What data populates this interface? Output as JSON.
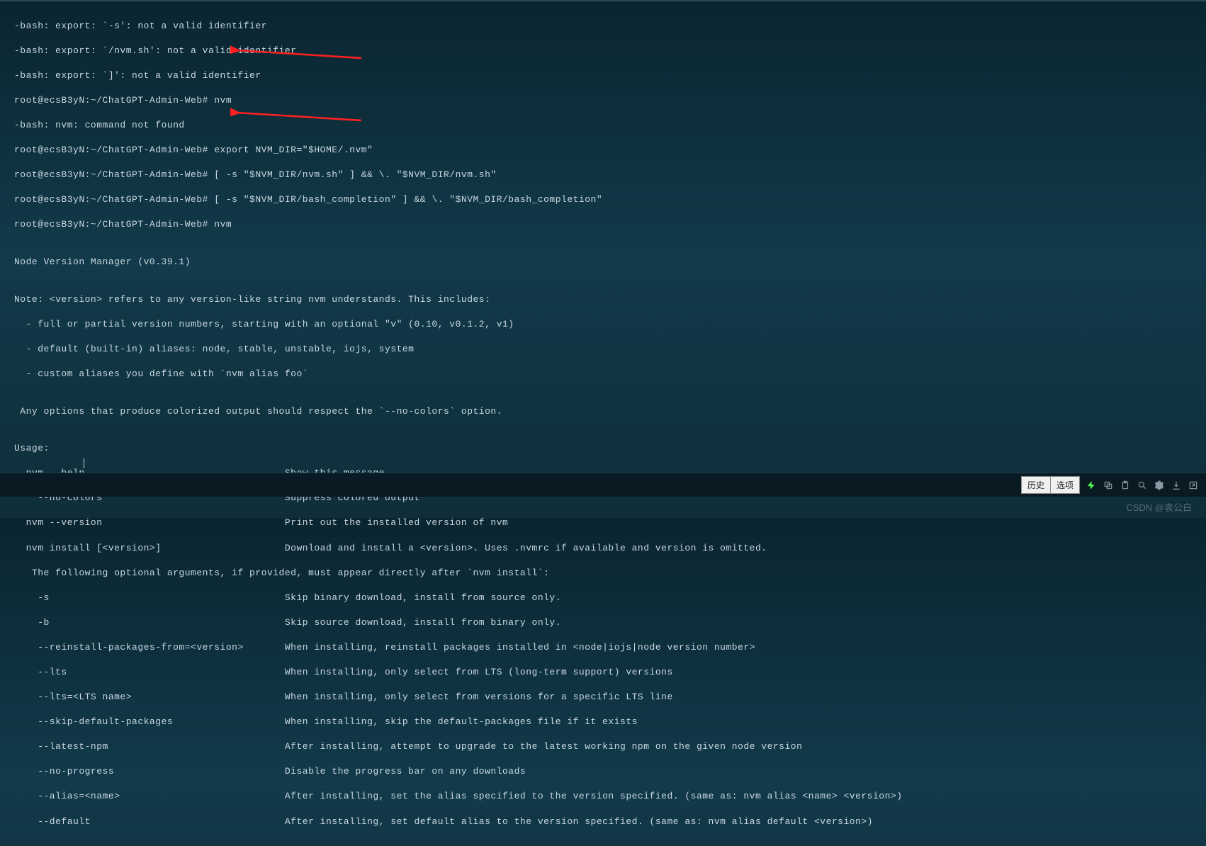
{
  "terminal": {
    "lines": [
      "-bash: export: `-s': not a valid identifier",
      "-bash: export: `/nvm.sh': not a valid identifier",
      "-bash: export: `]': not a valid identifier",
      "root@ecsB3yN:~/ChatGPT-Admin-Web# nvm",
      "-bash: nvm: command not found",
      "root@ecsB3yN:~/ChatGPT-Admin-Web# export NVM_DIR=\"$HOME/.nvm\"",
      "root@ecsB3yN:~/ChatGPT-Admin-Web# [ -s \"$NVM_DIR/nvm.sh\" ] && \\. \"$NVM_DIR/nvm.sh\"",
      "root@ecsB3yN:~/ChatGPT-Admin-Web# [ -s \"$NVM_DIR/bash_completion\" ] && \\. \"$NVM_DIR/bash_completion\"",
      "root@ecsB3yN:~/ChatGPT-Admin-Web# nvm",
      "",
      "Node Version Manager (v0.39.1)",
      "",
      "Note: <version> refers to any version-like string nvm understands. This includes:",
      "  - full or partial version numbers, starting with an optional \"v\" (0.10, v0.1.2, v1)",
      "  - default (built-in) aliases: node, stable, unstable, iojs, system",
      "  - custom aliases you define with `nvm alias foo`",
      "",
      " Any options that produce colorized output should respect the `--no-colors` option.",
      "",
      "Usage:",
      "  nvm --help                                  Show this message",
      "    --no-colors                               Suppress colored output",
      "  nvm --version                               Print out the installed version of nvm",
      "  nvm install [<version>]                     Download and install a <version>. Uses .nvmrc if available and version is omitted.",
      "   The following optional arguments, if provided, must appear directly after `nvm install`:",
      "    -s                                        Skip binary download, install from source only.",
      "    -b                                        Skip source download, install from binary only.",
      "    --reinstall-packages-from=<version>       When installing, reinstall packages installed in <node|iojs|node version number>",
      "    --lts                                     When installing, only select from LTS (long-term support) versions",
      "    --lts=<LTS name>                          When installing, only select from versions for a specific LTS line",
      "    --skip-default-packages                   When installing, skip the default-packages file if it exists",
      "    --latest-npm                              After installing, attempt to upgrade to the latest working npm on the given node version",
      "    --no-progress                             Disable the progress bar on any downloads",
      "    --alias=<name>                            After installing, set the alias specified to the version specified. (same as: nvm alias <name> <version>)",
      "    --default                                 After installing, set default alias to the version specified. (same as: nvm alias default <version>)"
    ]
  },
  "bottombar": {
    "history_btn": "历史",
    "options_btn": "选项"
  },
  "watermark": "CSDN @袁公白",
  "arrows": {
    "color": "#ff2020"
  }
}
